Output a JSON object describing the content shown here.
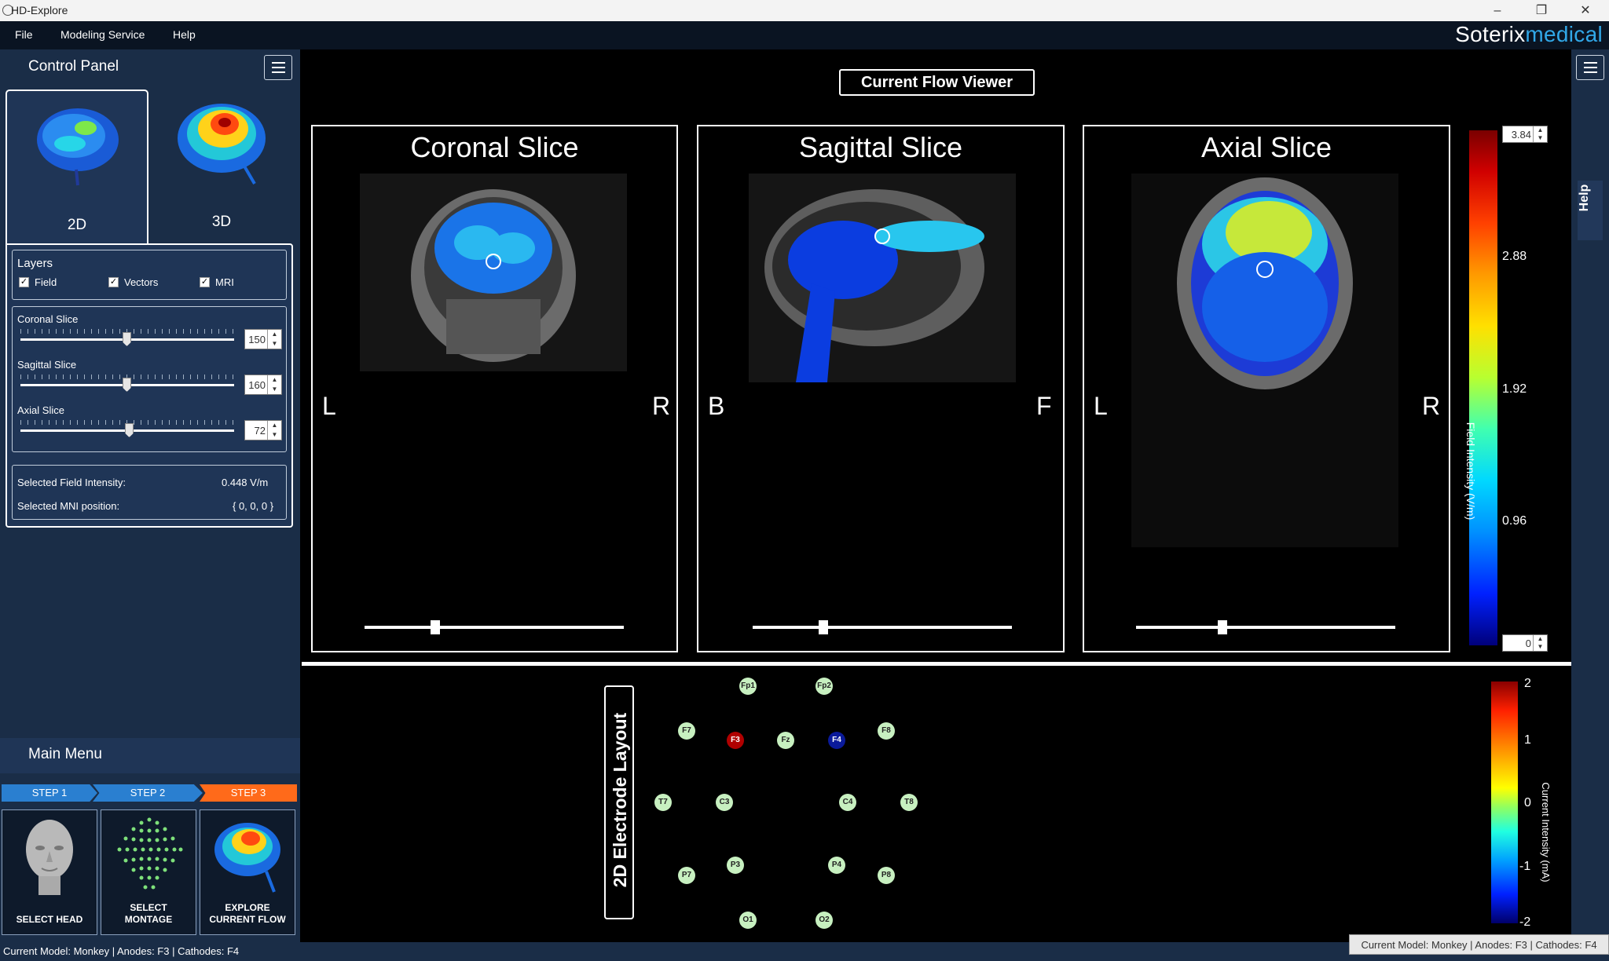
{
  "window": {
    "title": "HD-Explore",
    "controls": [
      "–",
      "❐",
      "✕"
    ]
  },
  "menubar": {
    "items": [
      "File",
      "Modeling Service",
      "Help"
    ],
    "brand_a": "Soterix",
    "brand_b": "medical"
  },
  "control_panel": {
    "title": "Control Panel",
    "tabs": [
      {
        "label": "2D"
      },
      {
        "label": "3D"
      }
    ],
    "layers": {
      "title": "Layers",
      "items": [
        {
          "label": "Field",
          "checked": true
        },
        {
          "label": "Vectors",
          "checked": true
        },
        {
          "label": "MRI",
          "checked": true
        }
      ]
    },
    "sliders": [
      {
        "label": "Coronal Slice",
        "value": "150"
      },
      {
        "label": "Sagittal Slice",
        "value": "160"
      },
      {
        "label": "Axial Slice",
        "value": "72"
      }
    ],
    "info": [
      {
        "label": "Selected Field Intensity:",
        "value": "0.448 V/m"
      },
      {
        "label": "Selected MNI position:",
        "value": "{ 0, 0, 0 }"
      }
    ]
  },
  "main_menu": {
    "title": "Main Menu",
    "steps": [
      "STEP 1",
      "STEP 2",
      "STEP 3"
    ],
    "cards": [
      {
        "label1": "SELECT HEAD",
        "label2": ""
      },
      {
        "label1": "SELECT",
        "label2": "MONTAGE"
      },
      {
        "label1": "EXPLORE",
        "label2": "CURRENT FLOW"
      }
    ]
  },
  "status": {
    "left": "Current Model: Monkey  |  Anodes: F3  |  Cathodes: F4",
    "right": "Current Model: Monkey  |  Anodes: F3  |  Cathodes: F4"
  },
  "viewer": {
    "title": "Current Flow Viewer",
    "slices": [
      {
        "title": "Coronal Slice",
        "left": "L",
        "right": "R"
      },
      {
        "title": "Sagittal Slice",
        "left": "B",
        "right": "F"
      },
      {
        "title": "Axial Slice",
        "left": "L",
        "right": "R"
      }
    ],
    "colorbar": {
      "max": "3.84",
      "min": "0",
      "ticks": [
        "2.88",
        "1.92",
        "0.96"
      ],
      "unit": "Field Intensity (V/m)"
    },
    "help": "Help"
  },
  "electrodes": {
    "title": "2D Electrode Layout",
    "items": [
      {
        "name": "Fp1"
      },
      {
        "name": "Fp2"
      },
      {
        "name": "F7"
      },
      {
        "name": "F3",
        "role": "anode"
      },
      {
        "name": "Fz"
      },
      {
        "name": "F4",
        "role": "cathode"
      },
      {
        "name": "F8"
      },
      {
        "name": "T7"
      },
      {
        "name": "C3"
      },
      {
        "name": "C4"
      },
      {
        "name": "T8"
      },
      {
        "name": "P7"
      },
      {
        "name": "P3"
      },
      {
        "name": "P4"
      },
      {
        "name": "P8"
      },
      {
        "name": "O1"
      },
      {
        "name": "O2"
      }
    ],
    "colorbar": {
      "ticks": [
        "2",
        "1",
        "0",
        "-1",
        "-2"
      ],
      "unit": "Current Intensity (mA)"
    }
  },
  "colors": {
    "accent": "#31a8e8",
    "panel": "#1a2d47",
    "step3": "#ff6a1a",
    "step": "#2a7fd0",
    "anode": "#b00000",
    "cathode": "#0a1a9a",
    "electrode": "#c7f0c0"
  }
}
